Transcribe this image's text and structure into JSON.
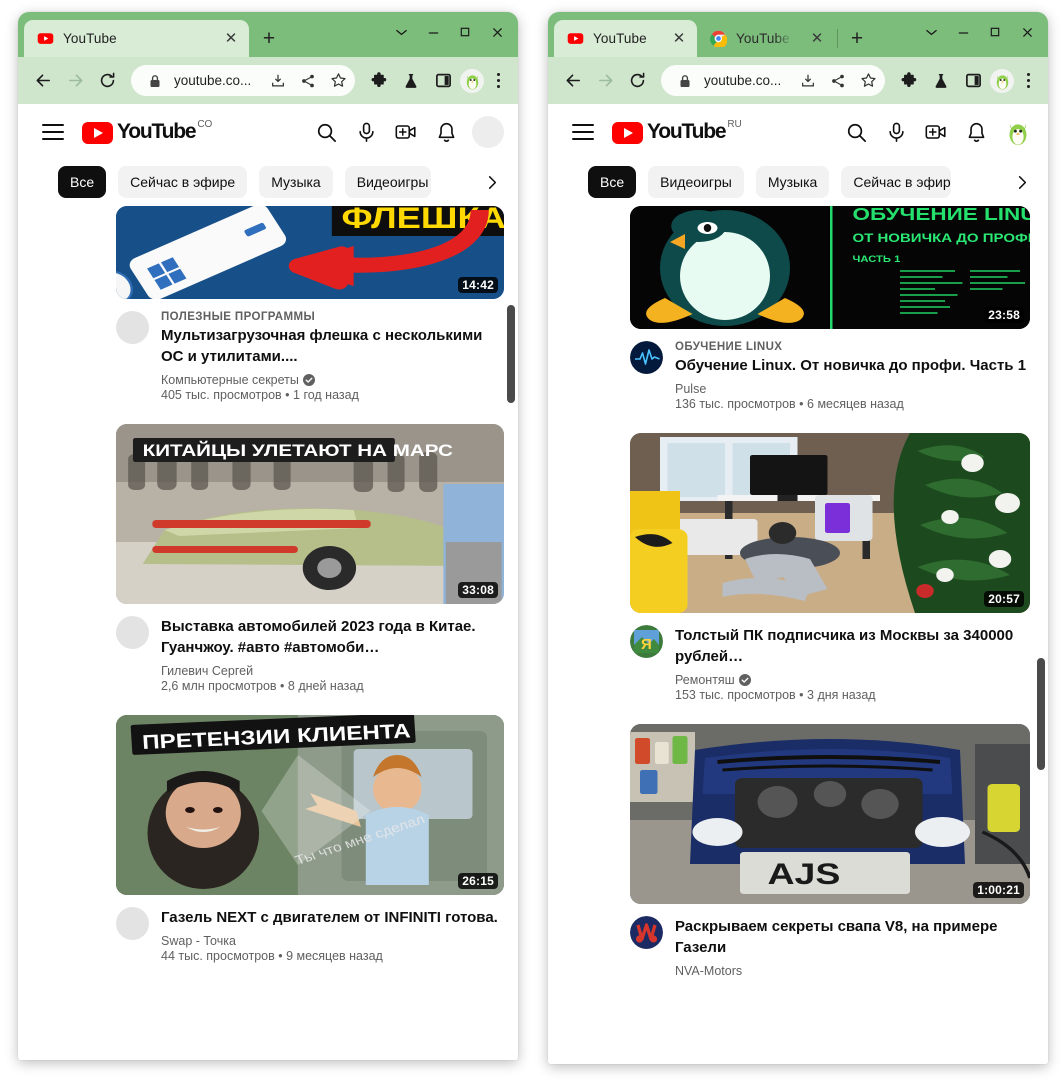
{
  "windows": [
    {
      "id": "window-left",
      "tabs": [
        {
          "title": "YouTube",
          "favicon": "youtube-icon",
          "active": true,
          "closable": true
        }
      ],
      "new_tab_label": "+",
      "window_controls": {
        "expand": "chevron-down-icon",
        "minimize": "minimize-icon",
        "maximize": "maximize-icon",
        "close": "close-icon"
      },
      "toolbar": {
        "back": "back-arrow-icon",
        "forward": "forward-arrow-icon",
        "reload": "reload-icon",
        "lock": "lock-icon",
        "url": "youtube.co...",
        "install": "install-icon",
        "share": "share-icon",
        "bookmark": "star-icon",
        "extensions": "puzzle-piece-icon",
        "labs": "flask-icon",
        "side_panel": "side-panel-icon",
        "profile": "penguin-avatar-icon",
        "menu": "kebab-menu-icon"
      },
      "youtube": {
        "logo_word": "YouTube",
        "country_code": "CO",
        "header_icons": [
          "search-icon",
          "microphone-icon",
          "create-video-icon",
          "notifications-icon"
        ],
        "avatar_type": "blank",
        "chips": [
          {
            "label": "Все",
            "active": true
          },
          {
            "label": "Сейчас в эфире",
            "active": false
          },
          {
            "label": "Музыка",
            "active": false
          },
          {
            "label": "Видеоигры",
            "active": false
          }
        ],
        "chip_next": "chevron-right-icon",
        "scrollbar": {
          "top_pct": 12,
          "height_pct": 22
        },
        "videos": [
          {
            "overline": "ПОЛЕЗНЫЕ ПРОГРАММЫ",
            "title": "Мультизагрузочная флешка с несколькими ОС и утилитами....",
            "channel": "Компьютерные секреты",
            "verified": true,
            "stats": "405 тыс. просмотров • 1 год назад",
            "duration": "14:42",
            "thumb_kind": "flash-drive-blue",
            "avatar_kind": "blank",
            "clipped_top": true
          },
          {
            "overline": "",
            "title": "Выставка автомобилей 2023 года в Китае. Гуанчжоу. #авто #автомоби…",
            "channel": "Гилевич Сергей",
            "verified": false,
            "stats": "2,6 млн просмотров • 8 дней назад",
            "duration": "33:08",
            "thumb_kind": "car-show",
            "avatar_kind": "blank",
            "banner": "КИТАЙЦЫ УЛЕТАЮТ НА МАРС"
          },
          {
            "overline": "",
            "title": "Газель NEXT с двигателем от INFINITI готова.",
            "channel": "Swap - Точка",
            "verified": false,
            "stats": "44 тыс. просмотров • 9 месяцев назад",
            "duration": "26:15",
            "thumb_kind": "claims-client",
            "avatar_kind": "blank",
            "banner": "ПРЕТЕНЗИИ КЛИЕНТА"
          }
        ]
      }
    },
    {
      "id": "window-right",
      "tabs": [
        {
          "title": "YouTube",
          "favicon": "youtube-icon",
          "active": true,
          "closable": true
        },
        {
          "title": "YouTube F",
          "favicon": "chrome-icon",
          "active": false,
          "closable": true
        }
      ],
      "new_tab_label": "+",
      "window_controls": {
        "expand": "chevron-down-icon",
        "minimize": "minimize-icon",
        "maximize": "maximize-icon",
        "close": "close-icon"
      },
      "toolbar": {
        "back": "back-arrow-icon",
        "forward": "forward-arrow-icon",
        "reload": "reload-icon",
        "lock": "lock-icon",
        "url": "youtube.co...",
        "install": "install-icon",
        "share": "share-icon",
        "bookmark": "star-icon",
        "extensions": "puzzle-piece-icon",
        "labs": "flask-icon",
        "side_panel": "side-panel-icon",
        "profile": "penguin-avatar-icon",
        "menu": "kebab-menu-icon"
      },
      "youtube": {
        "logo_word": "YouTube",
        "country_code": "RU",
        "header_icons": [
          "search-icon",
          "microphone-icon",
          "create-video-icon",
          "notifications-icon"
        ],
        "avatar_type": "penguin",
        "chips": [
          {
            "label": "Все",
            "active": true
          },
          {
            "label": "Видеоигры",
            "active": false
          },
          {
            "label": "Музыка",
            "active": false
          },
          {
            "label": "Сейчас в эфире",
            "active": false
          }
        ],
        "chip_next": "chevron-right-icon",
        "scrollbar": {
          "top_pct": 56,
          "height_pct": 12
        },
        "videos": [
          {
            "overline": "ОБУЧЕНИЕ LINUX",
            "title": "Обучение Linux. От новичка до профи. Часть 1",
            "channel": "Pulse",
            "verified": false,
            "stats": "136 тыс. просмотров • 6 месяцев назад",
            "duration": "23:58",
            "thumb_kind": "linux-penguin",
            "avatar_kind": "pulse-blue",
            "clipped_top": true,
            "banner": "ОБУЧЕНИЕ LINUX",
            "banner2": "ОТ НОВИЧКА ДО ПРОФИ",
            "banner3": "ЧАСТЬ 1"
          },
          {
            "overline": "",
            "title": "Толстый ПК подписчика из Москвы за 340000 рублей…",
            "channel": "Ремонтяш",
            "verified": true,
            "stats": "153 тыс. просмотров • 3 дня назад",
            "duration": "20:57",
            "thumb_kind": "christmas-pc",
            "avatar_kind": "remontyash"
          },
          {
            "overline": "",
            "title": "Раскрываем секреты свапа V8, на примере Газели",
            "channel": "NVA-Motors",
            "verified": false,
            "stats": "",
            "duration": "1:00:21",
            "thumb_kind": "engine-swap",
            "avatar_kind": "nva-motors",
            "plate": "AJS"
          }
        ]
      }
    }
  ],
  "colors": {
    "tabstrip": "#7cbd7c",
    "toolbar": "#cfe6cd",
    "active_tab": "#d8ecd6",
    "youtube_red": "#ff0000",
    "chip_bg": "#f2f2f2",
    "chip_active_bg": "#0f0f0f",
    "text_primary": "#0f0f0f",
    "text_secondary": "#606060",
    "scrollbar_thumb": "#4a4a4a"
  }
}
